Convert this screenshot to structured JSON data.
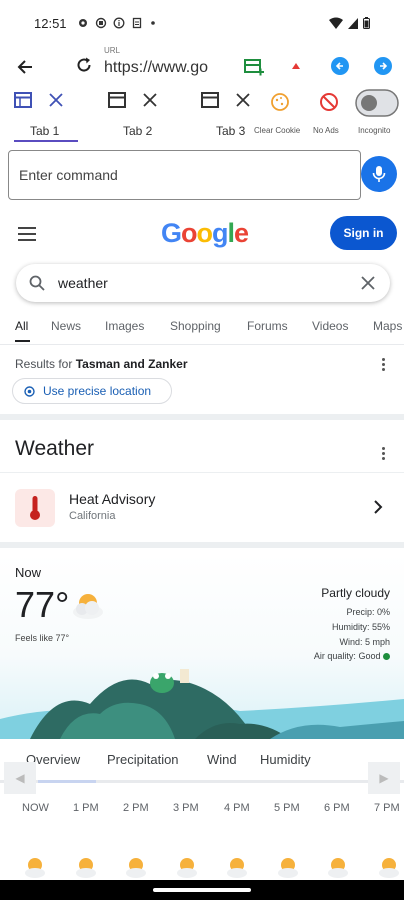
{
  "status_bar": {
    "time": "12:51"
  },
  "browser": {
    "url_label": "URL",
    "url_value": "https://www.google.com/search?q=weather",
    "tabs": [
      {
        "label": "Tab 1",
        "active": true
      },
      {
        "label": "Tab 2",
        "active": false
      },
      {
        "label": "Tab 3",
        "active": false
      }
    ],
    "actions": {
      "clear_cookie": "Clear Cookie",
      "no_ads": "No Ads",
      "incognito": "Incognito"
    },
    "command_placeholder": "Enter command"
  },
  "google": {
    "logo": [
      "G",
      "o",
      "o",
      "g",
      "l",
      "e"
    ],
    "logo_colors": [
      "#4285F4",
      "#EA4335",
      "#FBBC05",
      "#4285F4",
      "#34A853",
      "#EA4335"
    ],
    "signin": "Sign in",
    "query": "weather",
    "filters": [
      "All",
      "News",
      "Images",
      "Shopping",
      "Forums",
      "Videos",
      "Maps"
    ],
    "results_prefix": "Results for",
    "results_location": "Tasman and Zanker",
    "precise_location": "Use precise location"
  },
  "weather": {
    "title": "Weather",
    "advisory_title": "Heat Advisory",
    "advisory_region": "California",
    "now_label": "Now",
    "temperature": "77°",
    "feels_like": "Feels like 77°",
    "condition": "Partly cloudy",
    "precip": "Precip: 0%",
    "humidity": "Humidity: 55%",
    "wind": "Wind: 5 mph",
    "air_quality_label": "Air quality:",
    "air_quality_value": "Good",
    "hourly_tabs": [
      "Overview",
      "Precipitation",
      "Wind",
      "Humidity"
    ],
    "hours": [
      "NOW",
      "1 PM",
      "2 PM",
      "3 PM",
      "4 PM",
      "5 PM",
      "6 PM",
      "7 PM"
    ]
  },
  "colors": {
    "accent": "#1a73e8",
    "signin_bg": "#0b57d0",
    "tab_underline": "#5a4cc0",
    "alert": "#c5221f",
    "air_good": "#1e8e3e"
  }
}
